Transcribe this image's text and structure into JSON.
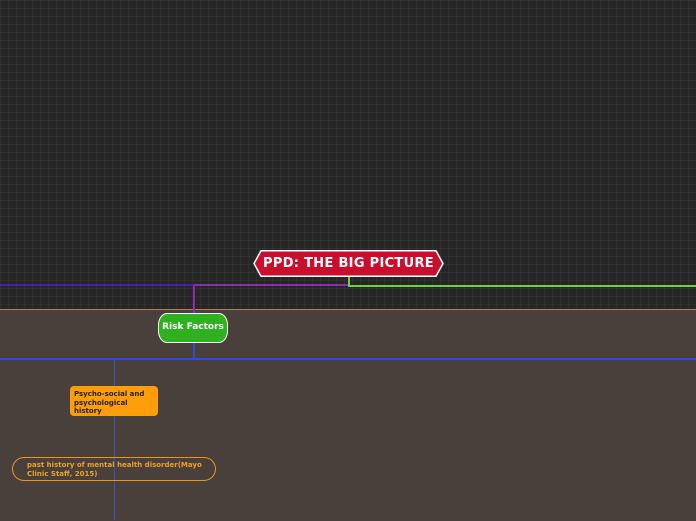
{
  "map": {
    "root": {
      "label": "PPD: THE BIG PICTURE",
      "color": "#c8102e"
    },
    "topic": {
      "label": "Risk Factors",
      "color": "#2fb021"
    },
    "subtopic": {
      "label": "Psycho-social and psychological history",
      "color": "#ff9e0a"
    },
    "leaf": {
      "label": "past history of mental health disorder(Mayo Clinic Staff, 2015)",
      "color": "#e8951d"
    }
  }
}
